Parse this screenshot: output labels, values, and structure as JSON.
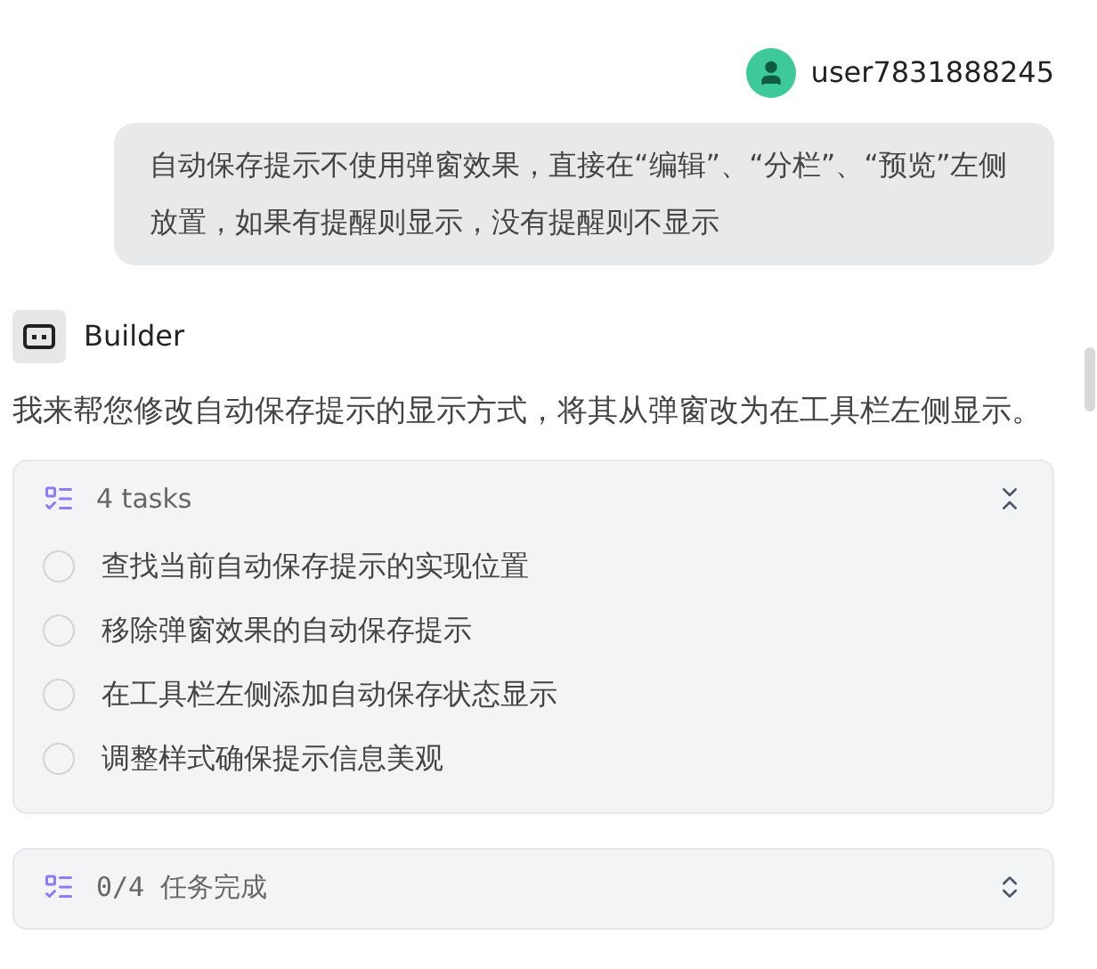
{
  "user_message": {
    "username": "user7831888245",
    "text": "自动保存提示不使用弹窗效果，直接在“编辑”、“分栏”、“预览”左侧放置，如果有提醒则显示，没有提醒则不显示"
  },
  "assistant": {
    "name": "Builder",
    "text": "我来帮您修改自动保存提示的显示方式，将其从弹窗改为在工具栏左侧显示。"
  },
  "task_list": {
    "title": "4 tasks",
    "expanded": true,
    "tasks": [
      {
        "label": "查找当前自动保存提示的实现位置",
        "checked": false
      },
      {
        "label": "移除弹窗效果的自动保存提示",
        "checked": false
      },
      {
        "label": "在工具栏左侧添加自动保存状态显示",
        "checked": false
      },
      {
        "label": "调整样式确保提示信息美观",
        "checked": false
      }
    ]
  },
  "progress_card": {
    "title": "0/4 任务完成",
    "expanded": false
  }
}
